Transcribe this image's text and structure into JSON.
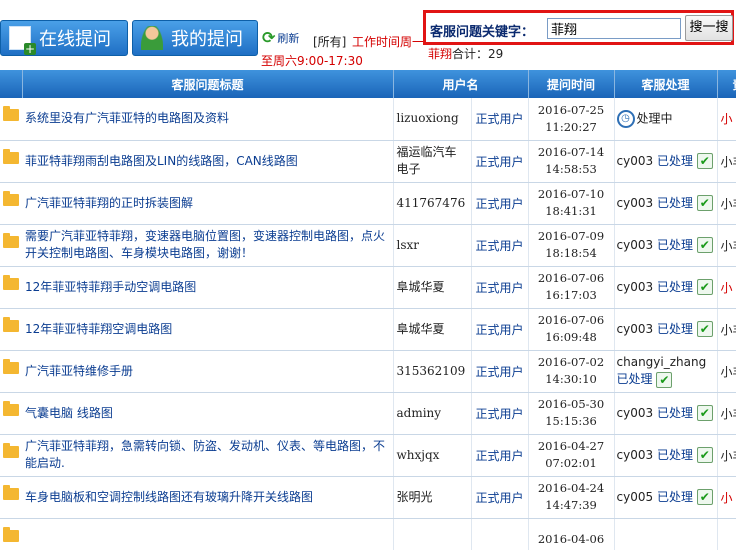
{
  "toolbar": {
    "online_button": "在线提问",
    "mine_button": "我的提问",
    "refresh_label": "刷新",
    "filter_all": "[所有]",
    "worktime_line1": "工作时间周一",
    "worktime_line2": "至周六9:00-17:30",
    "search_label": "客服问题关键字：",
    "search_value": "菲翔",
    "search_button": "搜一搜",
    "count_keyword": "菲翔",
    "count_label": "合计：",
    "count_value": "29"
  },
  "table": {
    "headers": [
      "客服问题标题",
      "用户名",
      "提问时间",
      "客服处理",
      "责"
    ],
    "rows": [
      {
        "title": "系统里没有广汽菲亚特的电路图及资料",
        "user": "lizuoxiong",
        "type": "正式用户",
        "date": "2016-07-25",
        "time": "11:20:27",
        "staff": "",
        "status": "处理中",
        "extra": "小"
      },
      {
        "title": "菲亚特菲翔雨刮电路图及LIN的线路图，CAN线路图",
        "user": "福运临汽车电子",
        "type": "正式用户",
        "date": "2016-07-14",
        "time": "14:58:53",
        "staff": "cy003",
        "status": "已处理",
        "extra": "小丰"
      },
      {
        "title": "广汽菲亚特菲翔的正时拆装图解",
        "user": "411767476",
        "type": "正式用户",
        "date": "2016-07-10",
        "time": "18:41:31",
        "staff": "cy003",
        "status": "已处理",
        "extra": "小丰"
      },
      {
        "title": "需要广汽菲亚特菲翔，变速器电脑位置图，变速器控制电路图，点火开关控制电路图、车身模块电路图，谢谢！",
        "user": "lsxr",
        "type": "正式用户",
        "date": "2016-07-09",
        "time": "18:18:54",
        "staff": "cy003",
        "status": "已处理",
        "extra": "小丰"
      },
      {
        "title": "12年菲亚特菲翔手动空调电路图",
        "user": "阜城华夏",
        "type": "正式用户",
        "date": "2016-07-06",
        "time": "16:17:03",
        "staff": "cy003",
        "status": "已处理",
        "extra": "小"
      },
      {
        "title": "12年菲亚特菲翔空调电路图",
        "user": "阜城华夏",
        "type": "正式用户",
        "date": "2016-07-06",
        "time": "16:09:48",
        "staff": "cy003",
        "status": "已处理",
        "extra": "小丰"
      },
      {
        "title": "广汽菲亚特维修手册",
        "user": "315362109",
        "type": "正式用户",
        "date": "2016-07-02",
        "time": "14:30:10",
        "staff": "changyi_zhang",
        "status": "已处理",
        "extra": "小丰"
      },
      {
        "title": "气囊电脑 线路图",
        "user": "adminy",
        "type": "正式用户",
        "date": "2016-05-30",
        "time": "15:15:36",
        "staff": "cy003",
        "status": "已处理",
        "extra": "小丰"
      },
      {
        "title": "广汽菲亚特菲翔，急需转向锁、防盗、发动机、仪表、等电路图，不能启动.",
        "user": "whxjqx",
        "type": "正式用户",
        "date": "2016-04-27",
        "time": "07:02:01",
        "staff": "cy003",
        "status": "已处理",
        "extra": "小丰"
      },
      {
        "title": "车身电脑板和空调控制线路图还有玻璃升降开关线路图",
        "user": "张明光",
        "type": "正式用户",
        "date": "2016-04-24",
        "time": "14:47:39",
        "staff": "cy005",
        "status": "已处理",
        "extra": "小"
      },
      {
        "title": "",
        "user": "",
        "type": "",
        "date": "2016-04-06",
        "time": "",
        "staff": "",
        "status": "",
        "extra": ""
      }
    ]
  },
  "colors": {
    "header_blue": "#1a64b8",
    "link_blue": "#0b3d91",
    "alert_red": "#d40000",
    "folder_yellow": "#f4b731",
    "check_green": "#1a9a1a"
  }
}
